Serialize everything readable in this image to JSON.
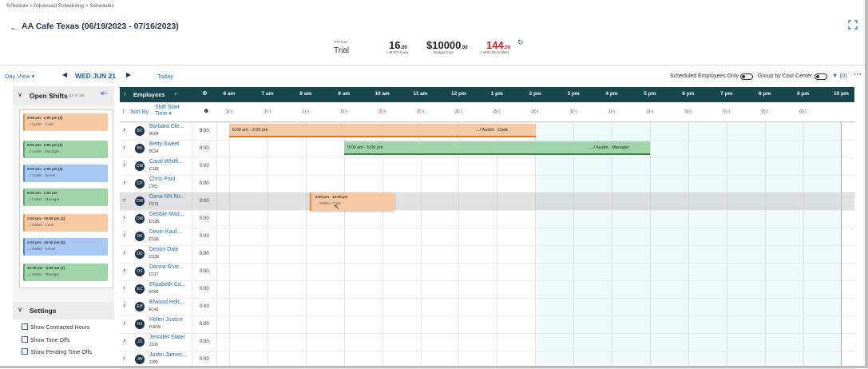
{
  "breadcrumb": "Schedule > Advanced Scheduling > Schedules",
  "page_title": "AA Cafe Texas (06/19/2023 - 07/16/2023)",
  "stats": {
    "status_label": "STATUS",
    "status_value": "Trial",
    "hours_value": "16",
    "hours_decimals": ".00",
    "hours_sub": "/ 48:00 Hours",
    "budget_value": "$10000",
    "budget_decimals": ".00",
    "budget_sub": "Budget Cost",
    "unfilled_value": "144",
    "unfilled_decimals": ".00",
    "unfilled_sub": "/ 4432.00 Unfilled"
  },
  "toolbar": {
    "day_view": "Day View",
    "current_date": "WED JUN 21",
    "today": "Today",
    "scheduled_only": "Scheduled Employees Only",
    "group_by_cost_center": "Group by Cost Center",
    "filter_count": "(0)"
  },
  "open_shifts": {
    "title": "Open Shifts",
    "count": "(18 of 18)",
    "cards": [
      {
        "time": "6:00 am - 2:00 pm (3)",
        "loc": ".../ Austin",
        "role": "Cook",
        "color": "#f6c9a4",
        "border": "#f28c38"
      },
      {
        "time": "6:00 am - 2:00 pm (2)",
        "loc": ".../ Austin",
        "role": "Manager",
        "color": "#9fd3a8",
        "border": "#4caf67"
      },
      {
        "time": "6:00 am - 2:00 pm (4)",
        "loc": ".../ Austin",
        "role": "Server",
        "color": "#a7c8f4",
        "border": "#4a86d8"
      },
      {
        "time": "6:00 am - 2:00 pm",
        "loc": ".../ Dallas",
        "role": "Manager",
        "color": "#9fd3a8",
        "border": "#4caf67"
      },
      {
        "time": "2:00 pm - 10:00 pm (4)",
        "loc": ".../ Dallas",
        "role": "Cook",
        "color": "#f6c9a4",
        "border": "#f28c38"
      },
      {
        "time": "2:00 pm - 10:00 pm (2)",
        "loc": ".../ Dallas",
        "role": "Server",
        "color": "#a7c8f4",
        "border": "#4a86d8"
      },
      {
        "time": "10:00 pm - 6:00 am (2)",
        "loc": ".../ Dallas",
        "role": "Manager",
        "color": "#9fd3a8",
        "border": "#4caf67"
      }
    ]
  },
  "settings": {
    "title": "Settings",
    "options": [
      "Show Contracted Hours",
      "Show Time Offs",
      "Show Pending Time Offs"
    ]
  },
  "grid": {
    "employees_label": "Employees",
    "sort_by_label": "Sort By:",
    "sort_by_value": "Shift Start Time",
    "hours": [
      "6 am",
      "7 am",
      "8 am",
      "9 am",
      "10 am",
      "11 am",
      "12 pm",
      "1 pm",
      "2 pm",
      "3 pm",
      "4 pm",
      "5 pm",
      "6 pm",
      "7 pm",
      "8 pm",
      "9 pm",
      "10 pm"
    ],
    "counts": [
      "1(-)",
      "1(-)",
      "1(-)",
      "2(-)",
      "2(-)",
      "2(-)",
      "2(-)",
      "2(-)",
      "2(-)",
      "1(-)",
      "1(-)",
      "1(-)",
      "0(-)",
      "0(-)",
      "0(-)",
      "0(-)"
    ]
  },
  "employees": [
    {
      "initials": "BC",
      "name": "Barbara Cle...",
      "code": "B104",
      "hours": "8:00"
    },
    {
      "initials": "BS",
      "name": "Betty Sweet",
      "code": "B114",
      "hours": "8:00"
    },
    {
      "initials": "CW",
      "name": "Carol Whitfi...",
      "code": "C118",
      "hours": "0:00"
    },
    {
      "initials": "CP",
      "name": "Chris Paul",
      "code": "CP3",
      "hours": "0:00"
    },
    {
      "initials": "DM",
      "name": "Dana NN Mc...",
      "code": "D131",
      "hours": "0:00"
    },
    {
      "initials": "DM",
      "name": "Debbie Mad...",
      "code": "D125",
      "hours": "0:00"
    },
    {
      "initials": "DK",
      "name": "Devin Kauf...",
      "code": "D126",
      "hours": "0:00"
    },
    {
      "initials": "DD",
      "name": "Devon Dale",
      "code": "D139",
      "hours": "0:00"
    },
    {
      "initials": "DS",
      "name": "Donna Shar...",
      "code": "D117",
      "hours": "0:00"
    },
    {
      "initials": "EC",
      "name": "Elizabeth Ca...",
      "code": "E105",
      "hours": "0:00"
    },
    {
      "initials": "EH",
      "name": "Elwood Holc...",
      "code": "E141",
      "hours": "0:00"
    },
    {
      "initials": "HJ",
      "name": "Helen Justice",
      "code": "HJKW",
      "hours": "0:00"
    },
    {
      "initials": "JS",
      "name": "Jennifer Slater",
      "code": "J106",
      "hours": "0:00"
    },
    {
      "initials": "JW",
      "name": "Justin James...",
      "code": "JJ99",
      "hours": "0:00"
    }
  ],
  "shifts": [
    {
      "time": "6:00 am - 2:00 pm",
      "loc": ".../ Austin",
      "role": "Cook",
      "color": "#f6c9a4",
      "border": "#e8741c"
    },
    {
      "time": "9:00 am - 5:00 pm",
      "loc": ".../ Austin",
      "role": "Manager",
      "color": "#9fd3a8",
      "border": "#2e8b47"
    }
  ],
  "drag_card": {
    "time": "2:00 pm - 10:00 pm",
    "loc": ".../ Dallas",
    "role": "Cook"
  }
}
